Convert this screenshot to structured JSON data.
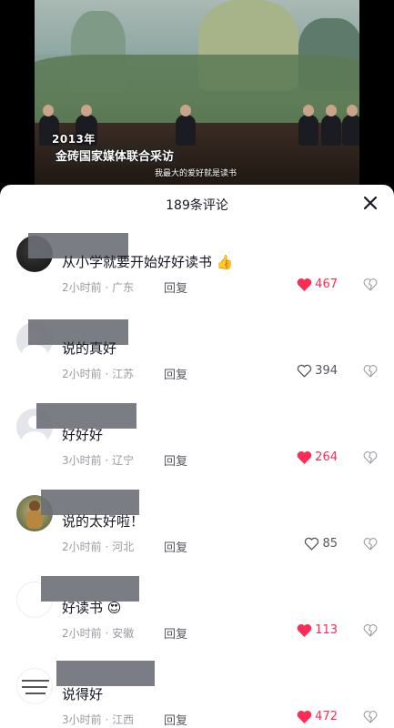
{
  "video": {
    "caption_line1": "2013年",
    "caption_line2": "金砖国家媒体联合采访",
    "subtitle": "我最大的爱好就是读书"
  },
  "comments_panel": {
    "title": "189条评论",
    "close_icon": "close-icon",
    "reply_label": "回复",
    "colors": {
      "liked": "#fe2c55",
      "unliked": "#56575e"
    },
    "comments": [
      {
        "text": "从小学就要开始好好读书",
        "emoji": "thumbs-up",
        "time": "2小时前",
        "location": "广东",
        "likes": "467",
        "liked": true
      },
      {
        "text": "说的真好",
        "time": "2小时前",
        "location": "江苏",
        "likes": "394",
        "liked": false
      },
      {
        "text": "好好好",
        "time": "3小时前",
        "location": "辽宁",
        "likes": "264",
        "liked": true
      },
      {
        "text": "说的太好啦！",
        "time": "2小时前",
        "location": "河北",
        "likes": "85",
        "liked": false
      },
      {
        "text": "好读书",
        "emoji": "heart-eyes",
        "time": "2小时前",
        "location": "安徽",
        "likes": "113",
        "liked": true
      },
      {
        "text": "说得好",
        "time": "3小时前",
        "location": "江西",
        "likes": "472",
        "liked": true
      }
    ]
  }
}
